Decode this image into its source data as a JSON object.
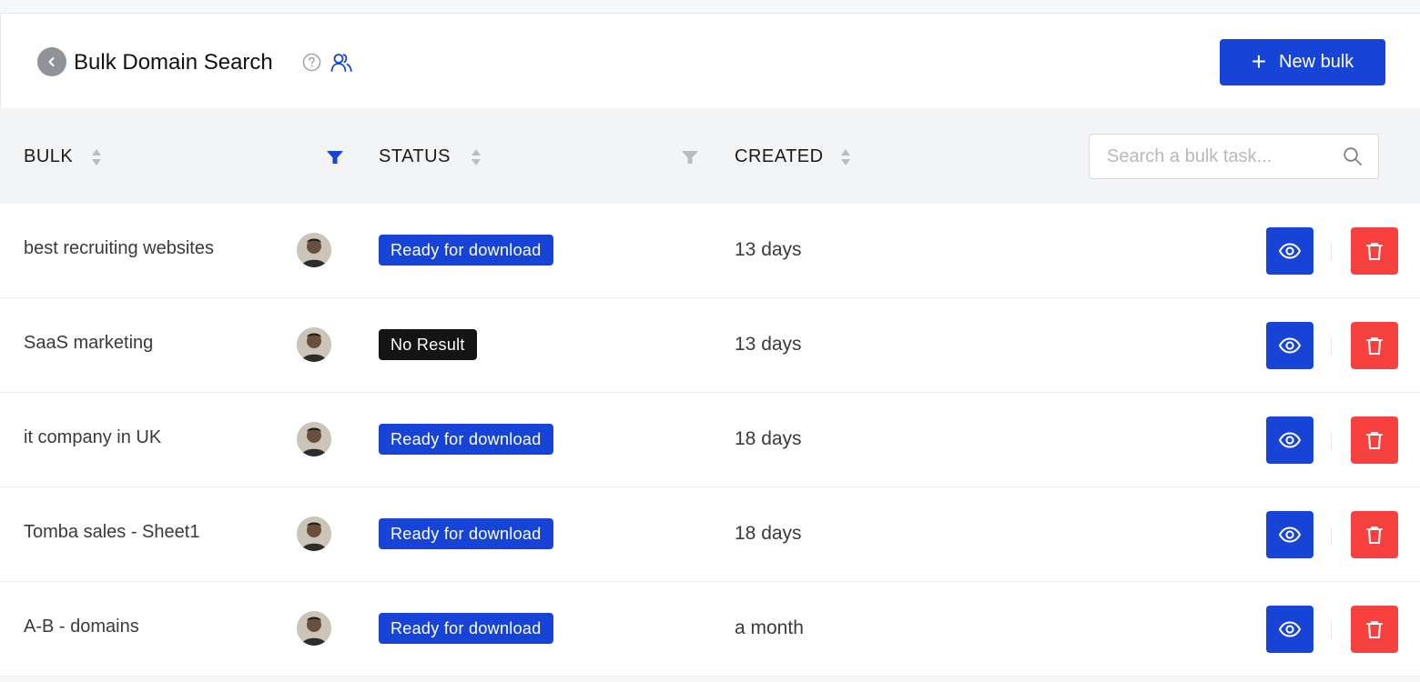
{
  "header": {
    "title": "Bulk Domain Search",
    "new_bulk_label": "New bulk"
  },
  "columns": {
    "bulk": "BULK",
    "status": "STATUS",
    "created": "CREATED"
  },
  "search": {
    "placeholder": "Search a bulk task..."
  },
  "colors": {
    "primary": "#1744d6",
    "danger": "#f6413e",
    "no_result": "#141414"
  },
  "rows": [
    {
      "name": "best recruiting websites",
      "status": "Ready for download",
      "created": "13 days"
    },
    {
      "name": "SaaS marketing",
      "status": "No Result",
      "created": "13 days"
    },
    {
      "name": "it company in UK",
      "status": "Ready for download",
      "created": "18 days"
    },
    {
      "name": "Tomba sales - Sheet1",
      "status": "Ready for download",
      "created": "18 days"
    },
    {
      "name": "A-B - domains",
      "status": "Ready for download",
      "created": "a month"
    }
  ]
}
